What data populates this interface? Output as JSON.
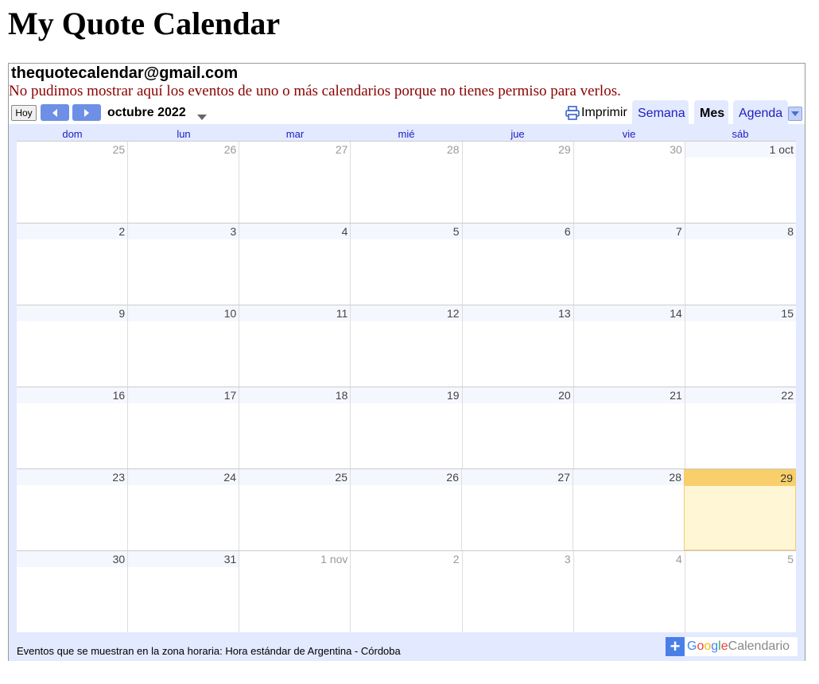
{
  "page": {
    "title": "My Quote Calendar"
  },
  "calendar": {
    "owner": "thequotecalendar@gmail.com",
    "error": "No pudimos mostrar aquí los eventos de uno o más calendarios porque no tienes permiso para verlos.",
    "toolbar": {
      "today_label": "Hoy",
      "month_label": "octubre 2022",
      "print_label": "Imprimir",
      "tabs": [
        "Semana",
        "Mes",
        "Agenda"
      ],
      "active_tab": "Mes"
    },
    "days_of_week": [
      "dom",
      "lun",
      "mar",
      "mié",
      "jue",
      "vie",
      "sáb"
    ],
    "weeks": [
      [
        {
          "n": "25",
          "o": true
        },
        {
          "n": "26",
          "o": true
        },
        {
          "n": "27",
          "o": true
        },
        {
          "n": "28",
          "o": true
        },
        {
          "n": "29",
          "o": true
        },
        {
          "n": "30",
          "o": true
        },
        {
          "n": "1 oct",
          "o": false
        }
      ],
      [
        {
          "n": "2"
        },
        {
          "n": "3"
        },
        {
          "n": "4"
        },
        {
          "n": "5"
        },
        {
          "n": "6"
        },
        {
          "n": "7"
        },
        {
          "n": "8"
        }
      ],
      [
        {
          "n": "9"
        },
        {
          "n": "10"
        },
        {
          "n": "11"
        },
        {
          "n": "12"
        },
        {
          "n": "13"
        },
        {
          "n": "14"
        },
        {
          "n": "15"
        }
      ],
      [
        {
          "n": "16"
        },
        {
          "n": "17"
        },
        {
          "n": "18"
        },
        {
          "n": "19"
        },
        {
          "n": "20"
        },
        {
          "n": "21"
        },
        {
          "n": "22"
        }
      ],
      [
        {
          "n": "23"
        },
        {
          "n": "24"
        },
        {
          "n": "25"
        },
        {
          "n": "26"
        },
        {
          "n": "27"
        },
        {
          "n": "28"
        },
        {
          "n": "29",
          "today": true
        }
      ],
      [
        {
          "n": "30"
        },
        {
          "n": "31"
        },
        {
          "n": "1 nov",
          "o": true
        },
        {
          "n": "2",
          "o": true
        },
        {
          "n": "3",
          "o": true
        },
        {
          "n": "4",
          "o": true
        },
        {
          "n": "5",
          "o": true
        }
      ]
    ],
    "footer": "Eventos que se muestran en la zona horaria: Hora estándar de Argentina - Córdoba",
    "badge": {
      "google": "Google",
      "label": "Calendario"
    },
    "colors": {
      "today_bg": "#fff6d6",
      "today_header": "#f8cf6a",
      "accent": "#6d8fe6",
      "error": "#8b0000"
    }
  }
}
